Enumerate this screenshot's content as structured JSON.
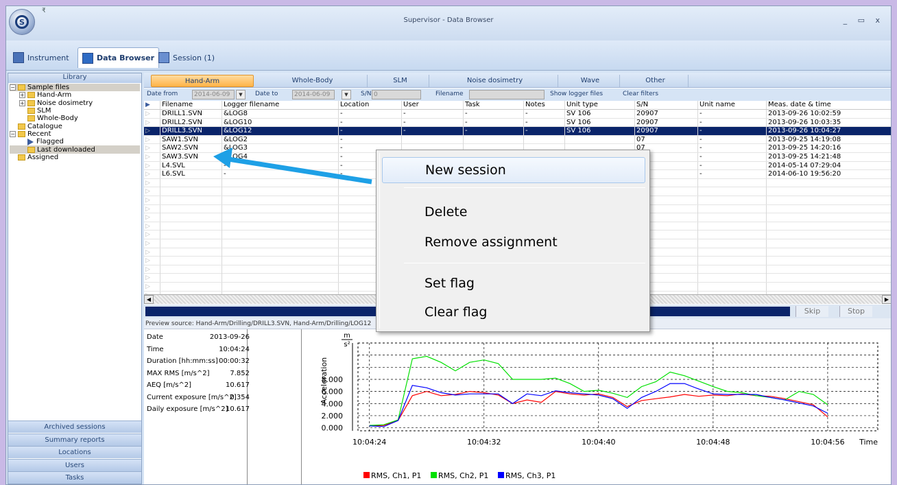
{
  "window": {
    "title": "Supervisor - Data Browser",
    "controls": "_ ▭ x",
    "qat": "₹"
  },
  "ribbon_tabs": [
    {
      "label": "Instrument",
      "icon": "instrument-icon"
    },
    {
      "label": "Data Browser",
      "icon": "data-browser-icon"
    },
    {
      "label": "Session (1)",
      "icon": "session-icon"
    }
  ],
  "library": {
    "header": "Library",
    "tree": [
      {
        "label": "Sample files",
        "exp": "⊟",
        "indent": 0,
        "icon": "folder"
      },
      {
        "label": "Hand-Arm",
        "exp": "⊞",
        "indent": 1,
        "icon": "folder"
      },
      {
        "label": "Noise dosimetry",
        "exp": "⊞",
        "indent": 1,
        "icon": "folder"
      },
      {
        "label": "SLM",
        "exp": "",
        "indent": 1,
        "icon": "folder"
      },
      {
        "label": "Whole-Body",
        "exp": "",
        "indent": 1,
        "icon": "folder"
      },
      {
        "label": "Catalogue",
        "exp": "",
        "indent": 0,
        "icon": "folder"
      },
      {
        "label": "Recent",
        "exp": "⊟",
        "indent": 0,
        "icon": "folder"
      },
      {
        "label": "Flagged",
        "exp": "",
        "indent": 1,
        "icon": "flag"
      },
      {
        "label": "Last downloaded",
        "exp": "",
        "indent": 1,
        "icon": "folder"
      },
      {
        "label": "Assigned",
        "exp": "",
        "indent": 0,
        "icon": "folder"
      }
    ],
    "nav": [
      "Archived sessions",
      "Summary reports",
      "Locations",
      "Users",
      "Tasks"
    ]
  },
  "filter_tabs": [
    "Hand-Arm",
    "Whole-Body",
    "SLM",
    "Noise dosimetry",
    "Wave",
    "Other"
  ],
  "filters": {
    "date_from_label": "Date from",
    "date_from": "2014-06-09",
    "date_to_label": "Date to",
    "date_to": "2014-06-09",
    "sn_label": "S/N",
    "sn": "0",
    "filename_label": "Filename",
    "show_logger": "Show logger files",
    "clear": "Clear filters"
  },
  "table": {
    "columns": [
      "Filename",
      "Logger filename",
      "Location",
      "User",
      "Task",
      "Notes",
      "Unit type",
      "S/N",
      "Unit name",
      "Meas. date & time"
    ],
    "rows": [
      [
        "DRILL1.SVN",
        "&LOG8",
        "-",
        "-",
        "-",
        "-",
        "SV 106",
        "20907",
        "-",
        "2013-09-26 10:02:59"
      ],
      [
        "DRILL2.SVN",
        "&LOG10",
        "-",
        "-",
        "-",
        "-",
        "SV 106",
        "20907",
        "-",
        "2013-09-26 10:03:35"
      ],
      [
        "DRILL3.SVN",
        "&LOG12",
        "-",
        "-",
        "-",
        "-",
        "SV 106",
        "20907",
        "-",
        "2013-09-26 10:04:27"
      ],
      [
        "SAW1.SVN",
        "&LOG2",
        "-",
        "",
        "",
        "",
        "",
        "07",
        "-",
        "2013-09-25 14:19:08"
      ],
      [
        "SAW2.SVN",
        "&LOG3",
        "-",
        "",
        "",
        "",
        "",
        "07",
        "-",
        "2013-09-25 14:20:16"
      ],
      [
        "SAW3.SVN",
        "&LOG4",
        "-",
        "",
        "",
        "",
        "",
        "07",
        "-",
        "2013-09-25 14:21:48"
      ],
      [
        "L4.SVL",
        "-",
        "-",
        "",
        "",
        "",
        "",
        "01",
        "-",
        "2014-05-14 07:29:04"
      ],
      [
        "L6.SVL",
        "-",
        "-",
        "",
        "",
        "",
        "",
        "0",
        "-",
        "2014-06-10 19:56:20"
      ]
    ],
    "selected_row": 2
  },
  "progress": {
    "skip": "Skip",
    "stop": "Stop"
  },
  "preview_source": "Preview source: Hand-Arm/Drilling/DRILL3.SVN, Hand-Arm/Drilling/LOG12",
  "stats": [
    {
      "k": "Date",
      "v": "2013-09-26"
    },
    {
      "k": "Time",
      "v": "10:04:24"
    },
    {
      "k": "Duration [hh:mm:ss]",
      "v": "00:00:32"
    },
    {
      "k": "MAX RMS [m/s^2]",
      "v": "7.852"
    },
    {
      "k": "AEQ [m/s^2]",
      "v": "10.617"
    },
    {
      "k": "Current exposure [m/s^2]",
      "v": "0.354"
    },
    {
      "k": "Daily exposure [m/s^2]",
      "v": "10.617"
    }
  ],
  "context_menu": [
    "New session",
    "Delete",
    "Remove assignment",
    "Set flag",
    "Clear flag"
  ],
  "chart_data": {
    "type": "line",
    "ylabel": "Acceleration",
    "yunit_num": "m",
    "yunit_den": "s²",
    "xlabel": "Time",
    "y_ticks": [
      "0.000",
      "2.000",
      "4.000",
      "6.000",
      "8.000"
    ],
    "ylim": [
      -0.5,
      14
    ],
    "x_ticks": [
      "10:04:24",
      "10:04:32",
      "10:04:40",
      "10:04:48",
      "10:04:56"
    ],
    "x_tick_values": [
      0,
      8,
      16,
      24,
      32
    ],
    "xlim": [
      -0.8,
      35.5
    ],
    "x": [
      0,
      1,
      2,
      3,
      4,
      5,
      6,
      7,
      8,
      9,
      10,
      11,
      12,
      13,
      14,
      15,
      16,
      17,
      18,
      19,
      20,
      21,
      22,
      23,
      24,
      25,
      26,
      27,
      28,
      29,
      30,
      31,
      32
    ],
    "series": [
      {
        "name": "RMS, Ch1, P1",
        "color": "#ff0000",
        "values": [
          0.3,
          0.4,
          1.2,
          5.3,
          6.0,
          5.3,
          5.5,
          6.0,
          5.8,
          5.4,
          4.0,
          4.6,
          4.2,
          6.0,
          5.6,
          5.4,
          5.6,
          5.0,
          3.5,
          4.5,
          4.8,
          5.1,
          5.5,
          5.2,
          5.4,
          5.3,
          5.6,
          5.3,
          5.2,
          4.8,
          4.3,
          3.8,
          1.8
        ]
      },
      {
        "name": "RMS, Ch2, P1",
        "color": "#00e000",
        "values": [
          0.4,
          0.5,
          1.3,
          11.4,
          11.8,
          10.8,
          9.4,
          10.8,
          11.2,
          10.6,
          8.0,
          8.0,
          8.0,
          8.2,
          7.3,
          6.0,
          6.2,
          5.7,
          5.0,
          6.8,
          7.6,
          9.2,
          8.6,
          7.7,
          6.8,
          6.0,
          5.8,
          5.3,
          5.0,
          4.6,
          6.0,
          5.5,
          3.8
        ]
      },
      {
        "name": "RMS, Ch3, P1",
        "color": "#0000ff",
        "values": [
          0.3,
          0.2,
          1.2,
          7.0,
          6.6,
          5.8,
          5.4,
          5.6,
          5.6,
          5.6,
          4.0,
          5.6,
          5.3,
          6.1,
          5.8,
          5.6,
          5.4,
          4.8,
          3.2,
          5.0,
          6.0,
          7.3,
          7.3,
          6.4,
          5.6,
          5.5,
          5.5,
          5.5,
          5.0,
          4.6,
          4.1,
          3.6,
          2.4
        ]
      }
    ]
  }
}
